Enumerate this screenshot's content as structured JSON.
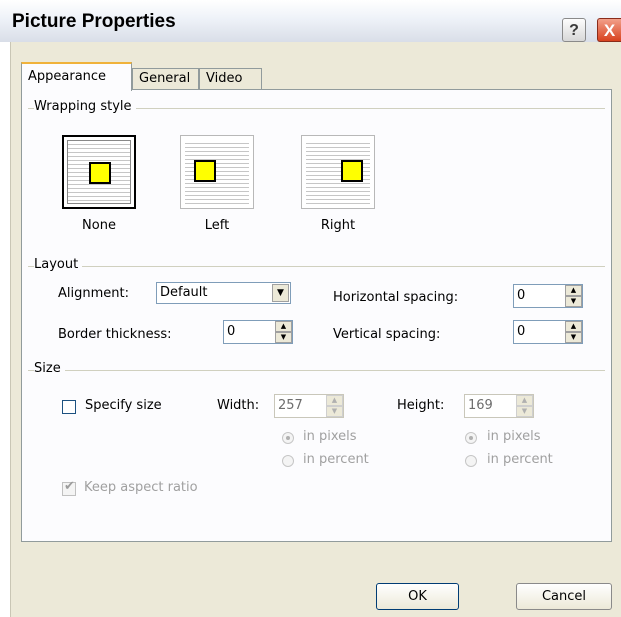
{
  "window": {
    "title": "Picture Properties",
    "help_glyph": "?",
    "close_glyph": "X"
  },
  "tabs": [
    {
      "label": "Appearance",
      "active": true
    },
    {
      "label": "General",
      "active": false
    },
    {
      "label": "Video",
      "active": false
    }
  ],
  "wrapping": {
    "group_label": "Wrapping style",
    "options": [
      {
        "label": "None",
        "selected": true
      },
      {
        "label": "Left",
        "selected": false
      },
      {
        "label": "Right",
        "selected": false
      }
    ]
  },
  "layout": {
    "group_label": "Layout",
    "alignment_label": "Alignment:",
    "alignment_value": "Default",
    "border_label": "Border thickness:",
    "border_value": "0",
    "hspacing_label": "Horizontal spacing:",
    "hspacing_value": "0",
    "vspacing_label": "Vertical spacing:",
    "vspacing_value": "0"
  },
  "size": {
    "group_label": "Size",
    "specify_label": "Specify size",
    "specify_checked": false,
    "width_label": "Width:",
    "width_value": "257",
    "height_label": "Height:",
    "height_value": "169",
    "in_pixels": "in pixels",
    "in_percent": "in percent",
    "keep_aspect_label": "Keep aspect ratio",
    "keep_aspect_checked": true
  },
  "buttons": {
    "ok": "OK",
    "cancel": "Cancel"
  }
}
